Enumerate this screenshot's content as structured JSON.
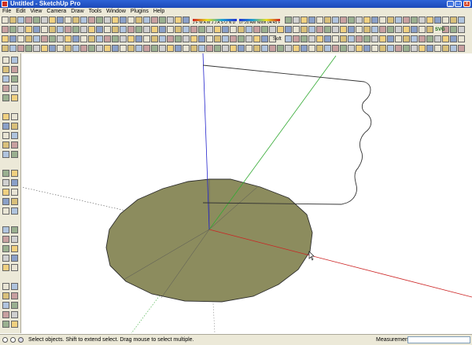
{
  "window": {
    "title": "Untitled - SketchUp Pro",
    "min_label": "_",
    "max_label": "□",
    "close_label": "x"
  },
  "menu": [
    "File",
    "Edit",
    "View",
    "Camera",
    "Draw",
    "Tools",
    "Window",
    "Plugins",
    "Help"
  ],
  "toolbar": {
    "date_gauge": "J F M A M J J A S O N D",
    "time_gauge": "07:20 AM   Noon   04:45 PM",
    "soft_label": "Soft",
    "svg_label": "SVG"
  },
  "status": {
    "message": "Select objects. Shift to extend select. Drag mouse to select multiple.",
    "measurements_label": "Measurements",
    "measurements_value": ""
  },
  "colors": {
    "face_fill": "#8c8c5e",
    "face_stroke": "#2c2c2c",
    "red_axis": "#cc2222",
    "green_axis": "#33aa33",
    "blue_axis": "#2222cc"
  },
  "icons": {
    "toolbar": "sketchup-tool-icons",
    "left_tools": "sketchup-large-tool-set-icons",
    "cursor": "arrow-cursor-icon"
  }
}
